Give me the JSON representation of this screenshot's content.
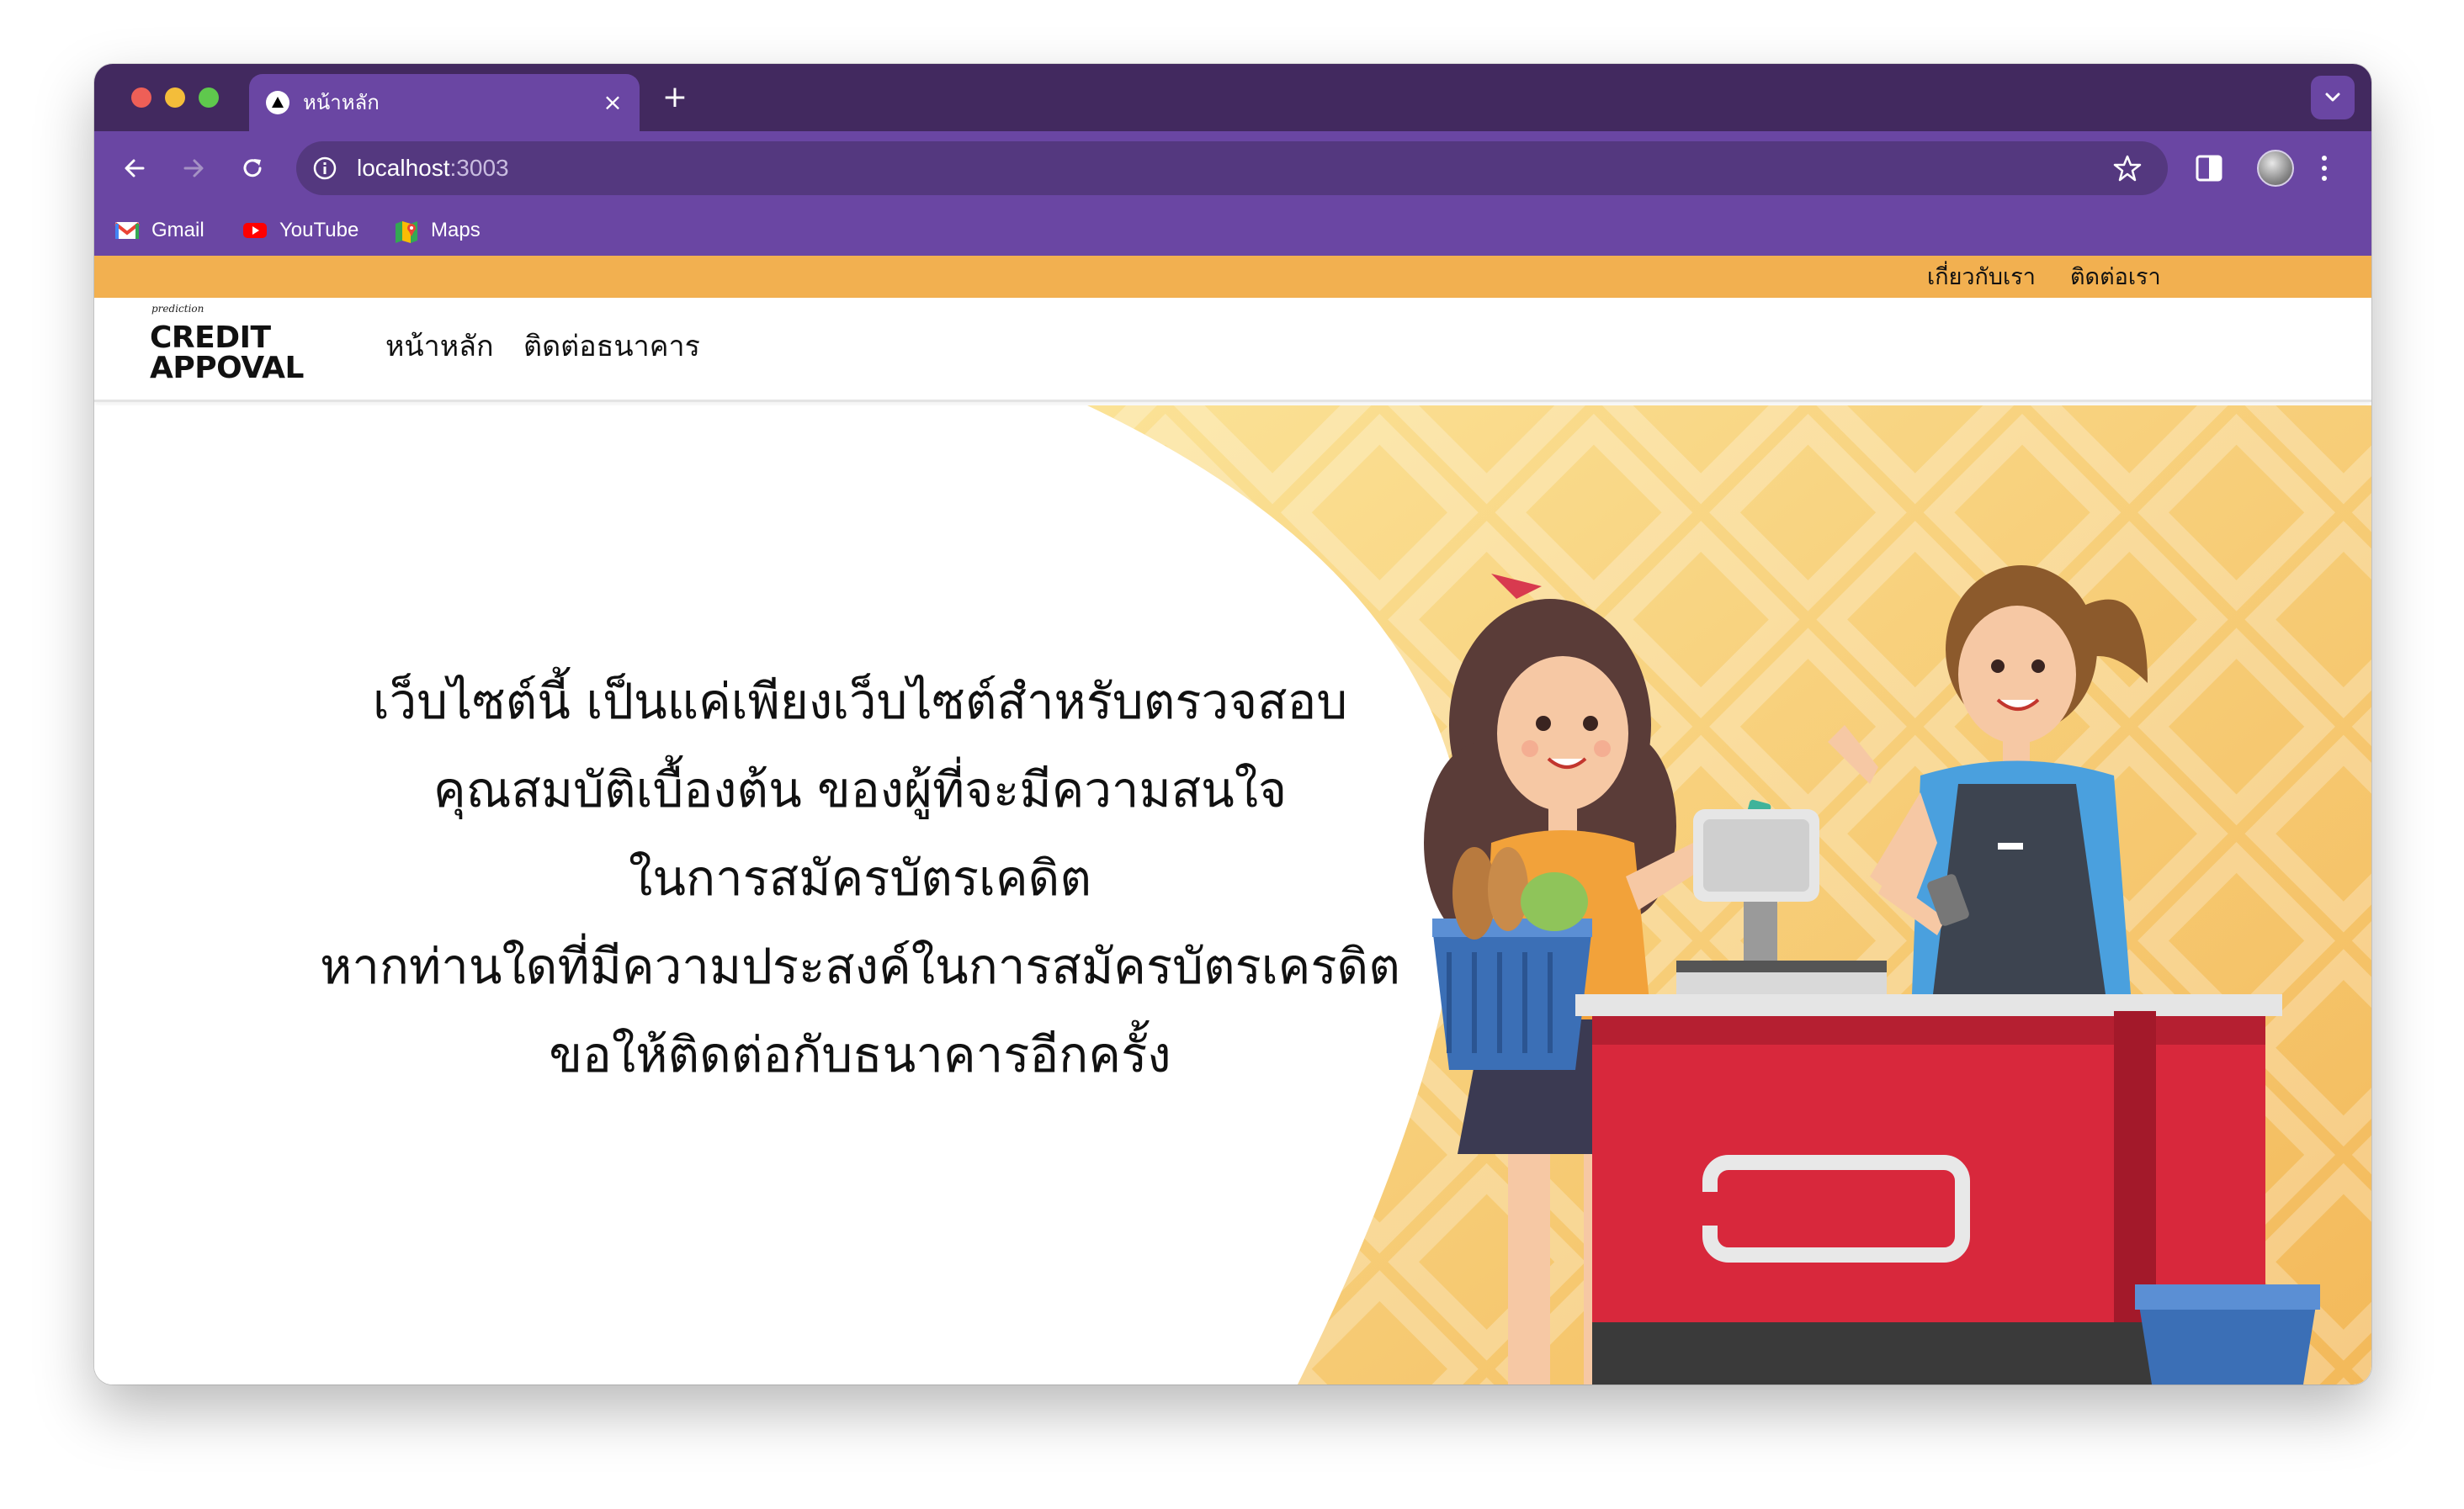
{
  "browser": {
    "tab": {
      "title": "หน้าหลัก",
      "close": "×"
    },
    "new_tab": "+",
    "url": {
      "host": "localhost",
      "port": ":3003"
    },
    "bookmarks": [
      {
        "label": "Gmail",
        "icon": "gmail-icon"
      },
      {
        "label": "YouTube",
        "icon": "youtube-icon"
      },
      {
        "label": "Maps",
        "icon": "maps-icon"
      }
    ]
  },
  "site": {
    "topbar": {
      "about": "เกี่ยวกับเรา",
      "contact": "ติดต่อเรา"
    },
    "logo": {
      "script": "prediction",
      "line1": "CREDIT",
      "line2": "APPOVAL"
    },
    "nav": {
      "home": "หน้าหลัก",
      "contact_bank": "ติดต่อธนาคาร"
    },
    "hero": {
      "lines": [
        "เว็บไซต์นี้ เป็นแค่เพียงเว็บไซต์สำหรับตรวจสอบ",
        "คุณสมบัติเบื้องต้น ของผู้ที่จะมีความสนใจ",
        "ในการสมัครบัตรเคดิต",
        "หากท่านใดที่มีความประสงค์ในการสมัครบัตรเครดิต",
        "ขอให้ติดต่อกับธนาคารอีกครั้ง"
      ]
    }
  },
  "colors": {
    "tabstrip": "#42295f",
    "toolbar": "#6a46a3",
    "topbar": "#f2b050",
    "hero_yellow": "#f7cf72",
    "counter_red": "#d8283c"
  }
}
